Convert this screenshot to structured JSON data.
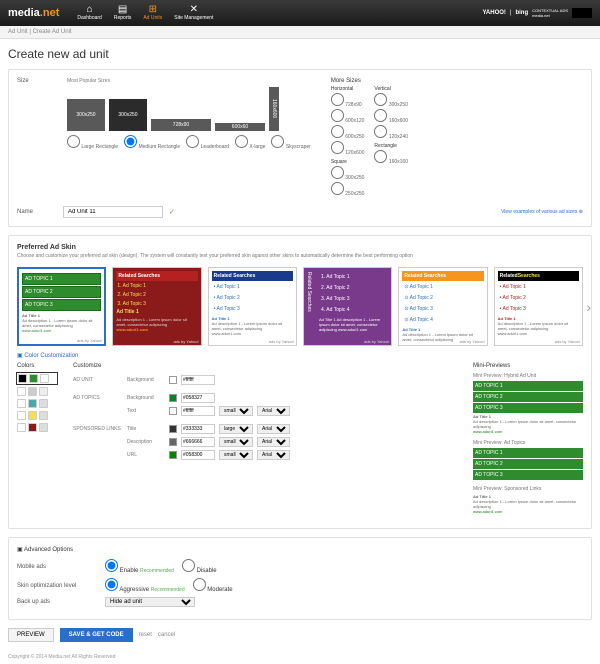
{
  "brand": {
    "name": "media",
    "suffix": ".net",
    "partner1": "YAHOO!",
    "partner2": "bing",
    "tagline": "CONTEXTUAL ADS",
    "network": "media.net"
  },
  "nav": {
    "dashboard": "Dashboard",
    "reports": "Reports",
    "adunits": "Ad Units",
    "site": "Site Management"
  },
  "crumb": "Ad Unit | Create Ad Unit",
  "title": "Create new ad unit",
  "size": {
    "label": "Size",
    "popular": "Most Popular Sizes",
    "b1": "300x250",
    "b2": "300x250",
    "b3": "728x90",
    "b4": "600x60",
    "bv": "160x600",
    "r1": "Large Rectangle",
    "r2": "Medium Rectangle",
    "r3": "Leaderboard",
    "r4": "X-large",
    "r5": "Skyscraper",
    "more": "More Sizes",
    "horiz": "Horizontal",
    "vert": "Vertical",
    "sq": "Square",
    "rect": "Rectangle",
    "h1": "728x90",
    "h2": "600x120",
    "h3": "600x250",
    "h4": "120x600",
    "v1": "300x250",
    "v2": "160x600",
    "v3": "120x240",
    "s1": "300x250",
    "s2": "250x250",
    "s3": "160x160"
  },
  "name": {
    "label": "Name",
    "value": "Ad Unit 11",
    "examples": "View examples of various ad sizes"
  },
  "skin": {
    "title": "Preferred Ad Skin",
    "desc": "Choose and customize your preferred ad skin (design). The system will constantly test your preferred skin against other skins to automatically determine the best performing option",
    "topic1": "AD TOPIC 1",
    "topic2": "AD TOPIC 2",
    "topic3": "AD TOPIC 3",
    "t1": "Ad Topic 1",
    "t2": "Ad Topic 2",
    "t3": "Ad Topic 3",
    "t4": "Ad Topic 4",
    "related": "Related Searches",
    "adtitle": "Ad Title 1",
    "desc_sm": "Ad description 1 - Lorem ipsum dolor sit amet, consectetur adipiscing",
    "url": "www.adurl1.com",
    "tag": "ads by Yahoo!"
  },
  "cc": {
    "link": "Color Customization",
    "colors": "Colors",
    "customize": "Customize",
    "preview": "Mini-Previews",
    "adunit": "AD UNIT",
    "bg": "Background",
    "bgv": "#ffffff",
    "adtopics": "AD TOPICS",
    "tbg": "Background",
    "tbgv": "#058327",
    "text": "Text",
    "textv": "#ffffff",
    "spons": "SPONSORED LINKS",
    "title_l": "Title",
    "titlev": "#333333",
    "desc_l": "Description",
    "descv": "#666666",
    "url_l": "URL",
    "urlv": "#058300",
    "small": "small",
    "large": "large",
    "arial": "Arial",
    "mp1": "Mini Preview: Hybrid Ad Unit",
    "mp2": "Mini Preview: Ad Topics",
    "mp3": "Mini Preview: Sponsored Links"
  },
  "adv": {
    "title": "Advanced Options",
    "mobile": "Mobile ads",
    "enable": "Enable",
    "disable": "Disable",
    "rec": "Recommended",
    "optim": "Skin optimization level",
    "agg": "Aggressive",
    "mod": "Moderate",
    "backup": "Back up ads",
    "hide": "Hide ad unit"
  },
  "btns": {
    "preview": "PREVIEW",
    "save": "SAVE & GET CODE",
    "reset": "reset",
    "cancel": "cancel"
  },
  "foot": "Copyright © 2014 Media.net All Rights Reserved"
}
